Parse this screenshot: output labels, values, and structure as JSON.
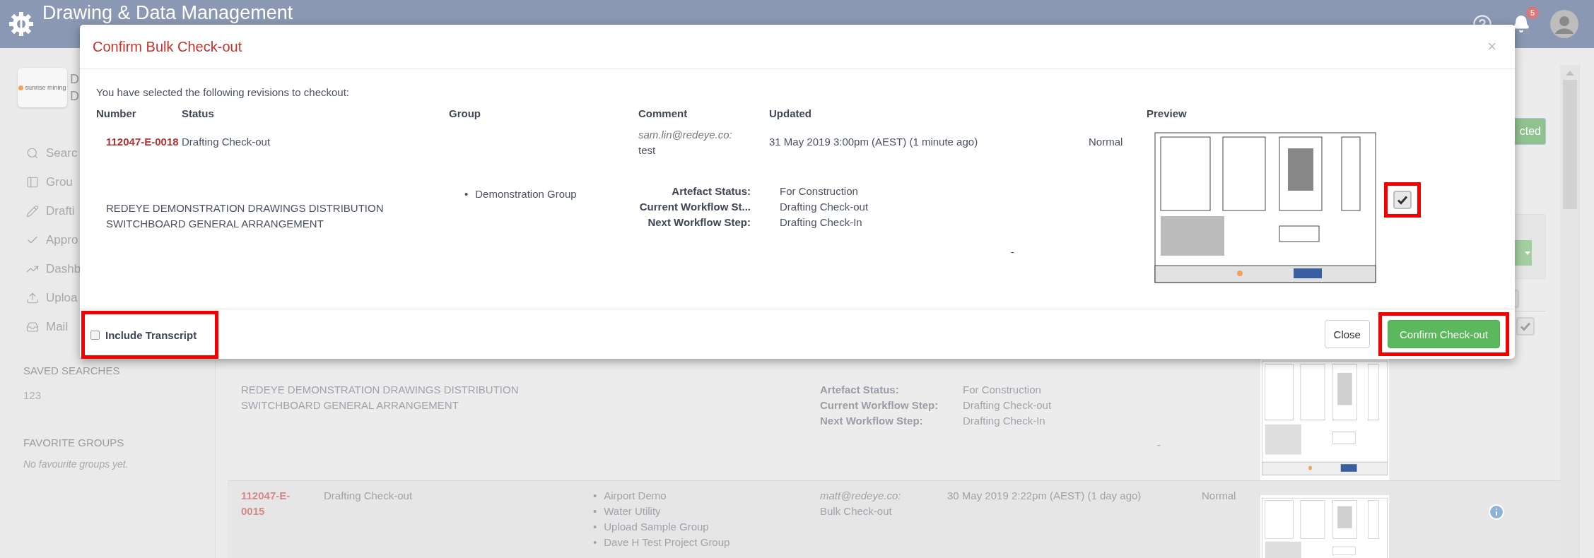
{
  "topbar": {
    "title": "Drawing & Data Management",
    "notifications": "5"
  },
  "sidebar": {
    "logo_text": "sunrise mining",
    "org_name": "D",
    "org_sub": "D",
    "items": [
      {
        "kind": "search",
        "label": "Searc"
      },
      {
        "kind": "groups",
        "label": "Grou"
      },
      {
        "kind": "drafting",
        "label": "Drafti"
      },
      {
        "kind": "approvals",
        "label": "Appro"
      },
      {
        "kind": "dashboard",
        "label": "Dashb"
      },
      {
        "kind": "upload",
        "label": "Uploa"
      },
      {
        "kind": "mail",
        "label": "Mail"
      }
    ],
    "saved_searches": {
      "title": "SAVED SEARCHES",
      "items": [
        "123"
      ]
    },
    "favorite_groups": {
      "title": "FAVORITE GROUPS",
      "empty_text": "No favourite groups yet."
    }
  },
  "background": {
    "side_button": "cted",
    "side_checkboxes": [
      {
        "checked": false
      },
      {
        "checked": true
      }
    ],
    "rows": [
      {
        "description_lines": [
          "REDEYE DEMONSTRATION DRAWINGS DISTRIBUTION",
          "SWITCHBOARD GENERAL ARRANGEMENT"
        ],
        "details": [
          {
            "label": "Artefact Status:",
            "value": "For Construction"
          },
          {
            "label": "Current Workflow Step:",
            "value": "Drafting Check-out"
          },
          {
            "label": "Next Workflow Step:",
            "value": "Drafting Check-In"
          }
        ],
        "dash": "-"
      },
      {
        "number": "112047-E-0015",
        "status": "Drafting Check-out",
        "bullet": "•",
        "groups": [
          "Airport Demo",
          "Water Utility",
          "Upload Sample Group",
          "Dave H Test Project Group"
        ],
        "comment_author": "matt@redeye.co:",
        "comment": "Bulk Check-out",
        "updated": "30 May 2019 2:22pm (AEST) (1 day ago)",
        "column_6": "Normal"
      }
    ]
  },
  "modal": {
    "title": "Confirm Bulk Check-out",
    "close": "×",
    "intro": "You have selected the following revisions to checkout:",
    "columns": [
      "Number",
      "Status",
      "Group",
      "Comment",
      "Updated",
      "Preview"
    ],
    "rows": [
      {
        "number": "112047-E-0018",
        "status": "Drafting Check-out",
        "comment_author": "sam.lin@redeye.co:",
        "comment": "test",
        "updated": "31 May 2019 3:00pm (AEST) (1 minute ago)",
        "column_6": "Normal",
        "description_lines": [
          "REDEYE DEMONSTRATION DRAWINGS DISTRIBUTION",
          "SWITCHBOARD GENERAL ARRANGEMENT"
        ],
        "bullet": "•",
        "groups": [
          "Demonstration Group"
        ],
        "details": [
          {
            "label": "Artefact Status:",
            "value": "For Construction"
          },
          {
            "label": "Current Workflow St...",
            "value": "Drafting Check-out"
          },
          {
            "label": "Next Workflow Step:",
            "value": "Drafting Check-In"
          }
        ],
        "dash": "-",
        "selected": true,
        "highlighted": true
      }
    ],
    "include_transcript": {
      "label": "Include Transcript",
      "checked": false,
      "highlighted": true
    },
    "buttons": [
      {
        "kind": "default",
        "label": "Close",
        "highlighted": false
      },
      {
        "kind": "primary",
        "label": "Confirm Check-out",
        "highlighted": true
      }
    ]
  }
}
